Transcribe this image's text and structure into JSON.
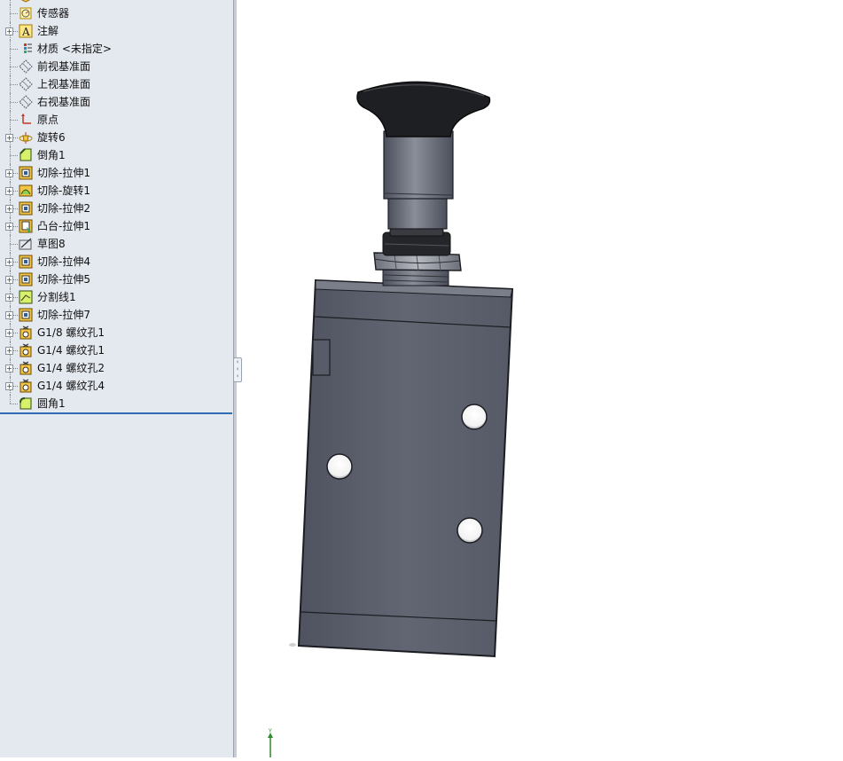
{
  "feature_tree": {
    "items": [
      {
        "label": "",
        "icon": "part-icon",
        "expandable": false
      },
      {
        "label": "传感器",
        "icon": "sensor-icon",
        "expandable": false
      },
      {
        "label": "注解",
        "icon": "annotation-icon",
        "expandable": true
      },
      {
        "label": "材质 <未指定>",
        "icon": "material-icon",
        "expandable": false
      },
      {
        "label": "前视基准面",
        "icon": "plane-icon",
        "expandable": false
      },
      {
        "label": "上视基准面",
        "icon": "plane-icon",
        "expandable": false
      },
      {
        "label": "右视基准面",
        "icon": "plane-icon",
        "expandable": false
      },
      {
        "label": "原点",
        "icon": "origin-icon",
        "expandable": false
      },
      {
        "label": "旋转6",
        "icon": "revolve-icon",
        "expandable": true
      },
      {
        "label": "倒角1",
        "icon": "chamfer-icon",
        "expandable": false
      },
      {
        "label": "切除-拉伸1",
        "icon": "cut-extrude-icon",
        "expandable": true
      },
      {
        "label": "切除-旋转1",
        "icon": "cut-revolve-icon",
        "expandable": true
      },
      {
        "label": "切除-拉伸2",
        "icon": "cut-extrude-icon",
        "expandable": true
      },
      {
        "label": "凸台-拉伸1",
        "icon": "boss-extrude-icon",
        "expandable": true
      },
      {
        "label": "草图8",
        "icon": "sketch-icon",
        "expandable": false
      },
      {
        "label": "切除-拉伸4",
        "icon": "cut-extrude-icon",
        "expandable": true
      },
      {
        "label": "切除-拉伸5",
        "icon": "cut-extrude-icon",
        "expandable": true
      },
      {
        "label": "分割线1",
        "icon": "split-line-icon",
        "expandable": true
      },
      {
        "label": "切除-拉伸7",
        "icon": "cut-extrude-icon",
        "expandable": true
      },
      {
        "label": "G1/8 螺纹孔1",
        "icon": "hole-wizard-icon",
        "expandable": true
      },
      {
        "label": "G1/4 螺纹孔1",
        "icon": "hole-wizard-icon",
        "expandable": true
      },
      {
        "label": "G1/4 螺纹孔2",
        "icon": "hole-wizard-icon",
        "expandable": true
      },
      {
        "label": "G1/4 螺纹孔4",
        "icon": "hole-wizard-icon",
        "expandable": true
      },
      {
        "label": "圆角1",
        "icon": "fillet-icon",
        "expandable": false
      }
    ]
  },
  "viewport": {
    "axis_label": "Y"
  },
  "colors": {
    "panel_bg": "#e4e8ef",
    "body_gray": "#5b5f6b",
    "knob_black": "#1e1f22",
    "accent_blue": "#2f6db5"
  }
}
